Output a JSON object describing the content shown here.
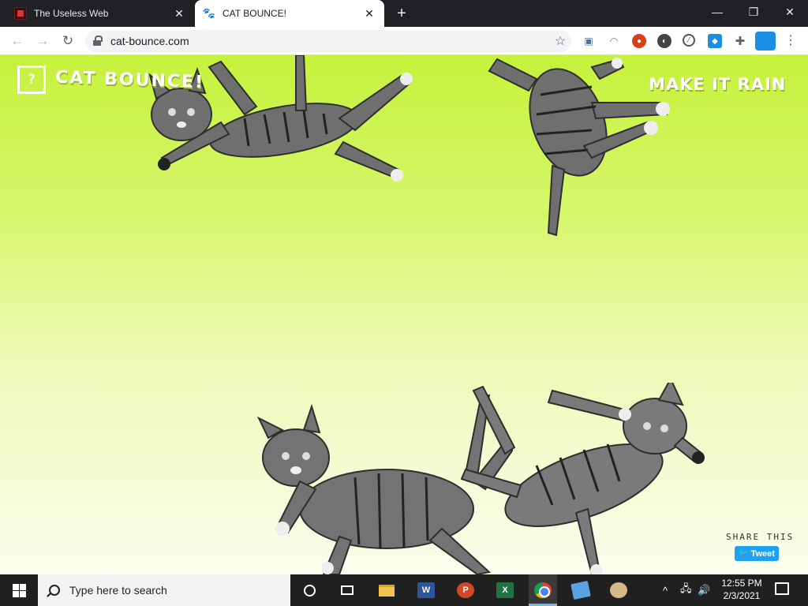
{
  "browser": {
    "tabs": [
      {
        "title": "The Useless Web",
        "active": false,
        "favicon": "useless-web-favicon"
      },
      {
        "title": "CAT BOUNCE!",
        "active": true,
        "favicon": "paw-icon"
      }
    ],
    "new_tab_glyph": "+",
    "close_glyph": "✕",
    "window_controls": {
      "minimize": "—",
      "restore": "❐",
      "close": "✕"
    },
    "address": "cat-bounce.com",
    "nav": {
      "back": "←",
      "forward": "→",
      "reload": "↻",
      "star": "☆",
      "menu": "⋮"
    },
    "extensions": [
      "photo-extension-icon",
      "rainbow-extension-icon",
      "ublock-icon",
      "dark-reader-icon",
      "block-icon",
      "blue-extension-icon",
      "puzzle-icon"
    ]
  },
  "page": {
    "help_label": "?",
    "logo_text": "CAT BOUNCE!",
    "rain_link": "MAKE IT RAIN",
    "share_label": "SHARE THIS",
    "tweet_label": "Tweet",
    "colors": {
      "top": "#c5f23c",
      "bottom": "#fbfeee",
      "tweet": "#1da1f2"
    }
  },
  "taskbar": {
    "search_placeholder": "Type here to search",
    "apps": [
      "cortana",
      "task-view",
      "file-explorer",
      "word",
      "powerpoint",
      "excel",
      "chrome",
      "sticky-notes",
      "paint"
    ],
    "word_letter": "W",
    "ppt_letter": "P",
    "excel_letter": "X",
    "tray_chevron": "^",
    "tray_network": "🖧",
    "tray_volume": "🔊",
    "time": "12:55 PM",
    "date": "2/3/2021"
  }
}
